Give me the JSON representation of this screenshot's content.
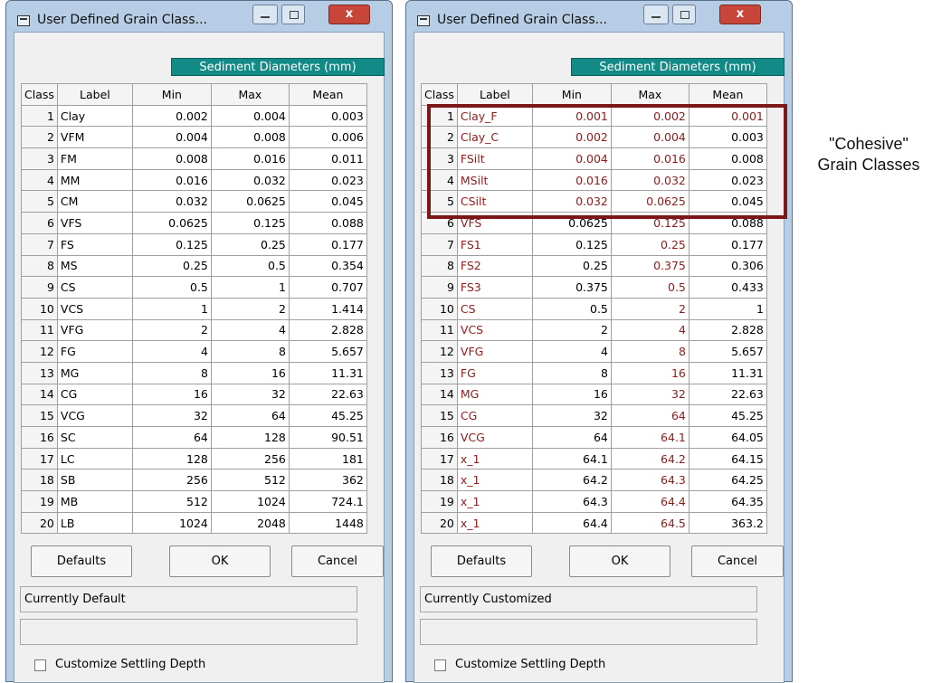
{
  "left_window": {
    "title": "User Defined Grain Class...",
    "header": "Sediment Diameters (mm)",
    "columns": [
      "Class",
      "Label",
      "Min",
      "Max",
      "Mean"
    ],
    "rows": [
      [
        "1",
        "Clay",
        "0.002",
        "0.004",
        "0.003"
      ],
      [
        "2",
        "VFM",
        "0.004",
        "0.008",
        "0.006"
      ],
      [
        "3",
        "FM",
        "0.008",
        "0.016",
        "0.011"
      ],
      [
        "4",
        "MM",
        "0.016",
        "0.032",
        "0.023"
      ],
      [
        "5",
        "CM",
        "0.032",
        "0.0625",
        "0.045"
      ],
      [
        "6",
        "VFS",
        "0.0625",
        "0.125",
        "0.088"
      ],
      [
        "7",
        "FS",
        "0.125",
        "0.25",
        "0.177"
      ],
      [
        "8",
        "MS",
        "0.25",
        "0.5",
        "0.354"
      ],
      [
        "9",
        "CS",
        "0.5",
        "1",
        "0.707"
      ],
      [
        "10",
        "VCS",
        "1",
        "2",
        "1.414"
      ],
      [
        "11",
        "VFG",
        "2",
        "4",
        "2.828"
      ],
      [
        "12",
        "FG",
        "4",
        "8",
        "5.657"
      ],
      [
        "13",
        "MG",
        "8",
        "16",
        "11.31"
      ],
      [
        "14",
        "CG",
        "16",
        "32",
        "22.63"
      ],
      [
        "15",
        "VCG",
        "32",
        "64",
        "45.25"
      ],
      [
        "16",
        "SC",
        "64",
        "128",
        "90.51"
      ],
      [
        "17",
        "LC",
        "128",
        "256",
        "181"
      ],
      [
        "18",
        "SB",
        "256",
        "512",
        "362"
      ],
      [
        "19",
        "MB",
        "512",
        "1024",
        "724.1"
      ],
      [
        "20",
        "LB",
        "1024",
        "2048",
        "1448"
      ]
    ],
    "buttons": {
      "defaults": "Defaults",
      "ok": "OK",
      "cancel": "Cancel"
    },
    "status": "Currently Default",
    "status2": "",
    "checkbox_label": "Customize Settling Depth"
  },
  "right_window": {
    "title": "User Defined Grain Class...",
    "header": "Sediment Diameters (mm)",
    "columns": [
      "Class",
      "Label",
      "Min",
      "Max",
      "Mean"
    ],
    "rows": [
      [
        "1",
        "Clay_F",
        "0.001",
        "0.002",
        "0.001"
      ],
      [
        "2",
        "Clay_C",
        "0.002",
        "0.004",
        "0.003"
      ],
      [
        "3",
        "FSilt",
        "0.004",
        "0.016",
        "0.008"
      ],
      [
        "4",
        "MSilt",
        "0.016",
        "0.032",
        "0.023"
      ],
      [
        "5",
        "CSilt",
        "0.032",
        "0.0625",
        "0.045"
      ],
      [
        "6",
        "VFS",
        "0.0625",
        "0.125",
        "0.088"
      ],
      [
        "7",
        "FS1",
        "0.125",
        "0.25",
        "0.177"
      ],
      [
        "8",
        "FS2",
        "0.25",
        "0.375",
        "0.306"
      ],
      [
        "9",
        "FS3",
        "0.375",
        "0.5",
        "0.433"
      ],
      [
        "10",
        "CS",
        "0.5",
        "2",
        "1"
      ],
      [
        "11",
        "VCS",
        "2",
        "4",
        "2.828"
      ],
      [
        "12",
        "VFG",
        "4",
        "8",
        "5.657"
      ],
      [
        "13",
        "FG",
        "8",
        "16",
        "11.31"
      ],
      [
        "14",
        "MG",
        "16",
        "32",
        "22.63"
      ],
      [
        "15",
        "CG",
        "32",
        "64",
        "45.25"
      ],
      [
        "16",
        "VCG",
        "64",
        "64.1",
        "64.05"
      ],
      [
        "17",
        "x_1",
        "64.1",
        "64.2",
        "64.15"
      ],
      [
        "18",
        "x_1",
        "64.2",
        "64.3",
        "64.25"
      ],
      [
        "19",
        "x_1",
        "64.3",
        "64.4",
        "64.35"
      ],
      [
        "20",
        "x_1",
        "64.4",
        "64.5",
        "363.2"
      ]
    ],
    "buttons": {
      "defaults": "Defaults",
      "ok": "OK",
      "cancel": "Cancel"
    },
    "status": "Currently Customized",
    "status2": "",
    "checkbox_label": "Customize Settling Depth"
  },
  "annotation": "\"Cohesive\" Grain Classes",
  "colors": {
    "header_teal": "#128a86",
    "highlight": "#7d1616",
    "custom_text": "#8f1b1b"
  }
}
